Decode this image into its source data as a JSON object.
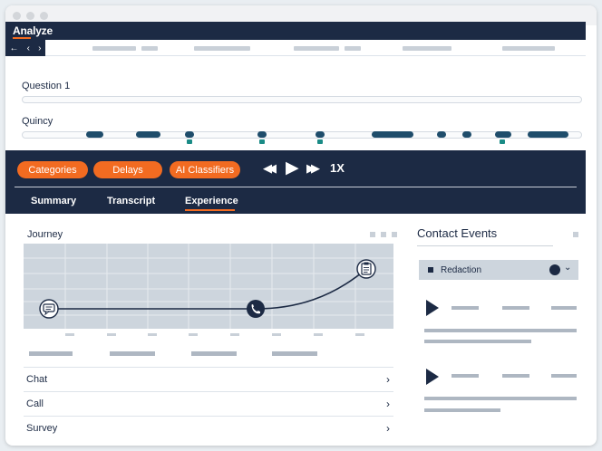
{
  "app": {
    "title": "Analyze"
  },
  "nav": {
    "back_icon": "arrow-left-icon",
    "prev_icon": "chevron-left-icon",
    "next_icon": "chevron-right-icon",
    "back_glyph": "←",
    "prev_glyph": "‹",
    "next_glyph": "›"
  },
  "questions": [
    {
      "label": "Question 1"
    },
    {
      "label": "Quincy"
    }
  ],
  "player": {
    "filters": [
      "Categories",
      "Delays",
      "AI Classifiers"
    ],
    "rewind_glyph": "◀◀",
    "play_glyph": "▶",
    "forward_glyph": "▶▶",
    "speed": "1X",
    "tabs": [
      {
        "label": "Summary",
        "active": false
      },
      {
        "label": "Transcript",
        "active": false
      },
      {
        "label": "Experience",
        "active": true
      }
    ]
  },
  "journey": {
    "title": "Journey",
    "steps": [
      {
        "icon": "chat-bubble-icon",
        "position": 0.06
      },
      {
        "icon": "phone-icon",
        "position": 0.63
      },
      {
        "icon": "clipboard-icon",
        "position": 0.92
      }
    ]
  },
  "channels": [
    {
      "label": "Chat",
      "chevron": "›"
    },
    {
      "label": "Call",
      "chevron": "›"
    },
    {
      "label": "Survey",
      "chevron": "›"
    }
  ],
  "contact_events": {
    "title": "Contact Events",
    "filter": {
      "label": "Redaction",
      "chevron": "⌄"
    }
  },
  "colors": {
    "navy": "#1c2a44",
    "accent": "#f26b21",
    "segment": "#1f4d6b",
    "marker": "#1a8b86"
  }
}
